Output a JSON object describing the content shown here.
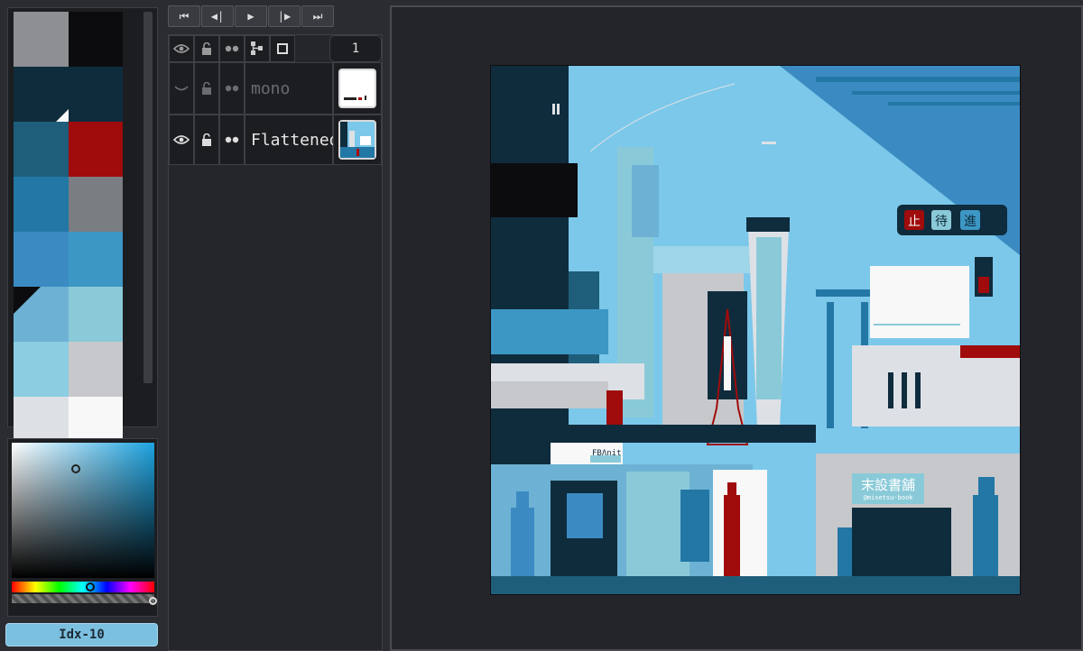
{
  "palette": {
    "swatches": [
      {
        "color": "#8d8f93"
      },
      {
        "color": "#0c0c0e"
      },
      {
        "color": "#0f2c3d"
      },
      {
        "color": "#0f2c3d"
      },
      {
        "color": "#1f5e7a"
      },
      {
        "color": "#a00b0b"
      },
      {
        "color": "#2377a5"
      },
      {
        "color": "#7a7d82"
      },
      {
        "color": "#3b8bc2"
      },
      {
        "color": "#3d97c4"
      },
      {
        "color": "#6db2d4"
      },
      {
        "color": "#8acad8"
      },
      {
        "color": "#8ccde2"
      },
      {
        "color": "#c7c8cb"
      },
      {
        "color": "#dde1e6"
      },
      {
        "color": "#f8f8f8"
      }
    ]
  },
  "color_picker": {
    "hue_color": "#1da3e0",
    "index_label": "Idx-10"
  },
  "playback": {
    "buttons": [
      {
        "name": "first-frame-button",
        "icon": "skip-to-start-icon",
        "glyph": "⏮"
      },
      {
        "name": "prev-frame-button",
        "icon": "step-back-icon",
        "glyph": "◀|"
      },
      {
        "name": "play-button",
        "icon": "play-icon",
        "glyph": "▶"
      },
      {
        "name": "next-frame-button",
        "icon": "step-forward-icon",
        "glyph": "|▶"
      },
      {
        "name": "last-frame-button",
        "icon": "skip-to-end-icon",
        "glyph": "⏭"
      }
    ]
  },
  "layers": {
    "frame_number": "1",
    "items": [
      {
        "name": "mono",
        "visible": false
      },
      {
        "name": "Flattened",
        "visible": true
      }
    ]
  },
  "canvas": {
    "sign_text": "末設書舗",
    "sign_handle": "@misetsu-book",
    "station_sign": "FBɅnit",
    "signal_chars": [
      "止",
      "待",
      "進"
    ]
  }
}
